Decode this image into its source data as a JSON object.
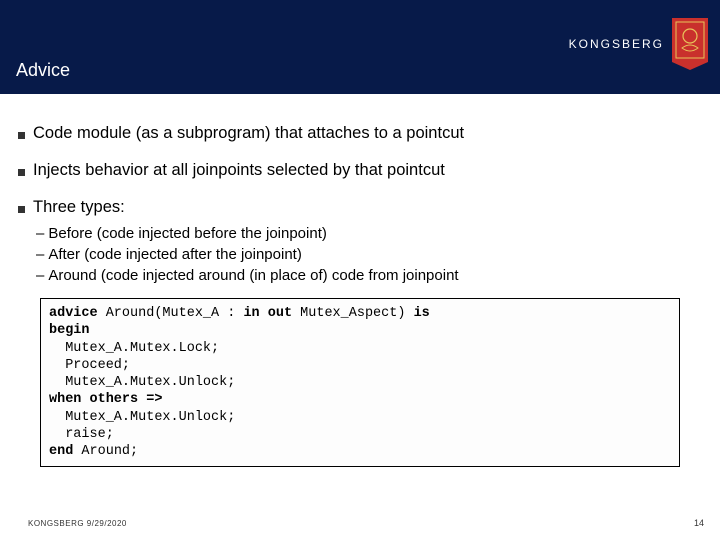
{
  "header": {
    "title": "Advice",
    "brand": "KONGSBERG"
  },
  "bullets": {
    "b1": "Code module (as a subprogram) that attaches to a pointcut",
    "b2": "Injects behavior at all joinpoints selected by that pointcut",
    "b3": "Three types:",
    "sub1": "Before (code injected before the joinpoint)",
    "sub2": "After (code injected after the joinpoint)",
    "sub3": "Around (code injected around (in place of) code from joinpoint"
  },
  "code": {
    "kw_advice": "advice",
    "l1_rest": " Around(Mutex_A : ",
    "kw_inout": "in out",
    "l1_end": " Mutex_Aspect) ",
    "kw_is": "is",
    "kw_begin": "begin",
    "l3": "  Mutex_A.Mutex.Lock;",
    "l4": "  Proceed;",
    "l5": "  Mutex_A.Mutex.Unlock;",
    "kw_when": "when others =>",
    "l7": "  Mutex_A.Mutex.Unlock;",
    "l8": "  raise;",
    "kw_end": "end",
    "l9_end": " Around;"
  },
  "footer": {
    "text": "KONGSBERG 9/29/2020",
    "page": "14"
  }
}
